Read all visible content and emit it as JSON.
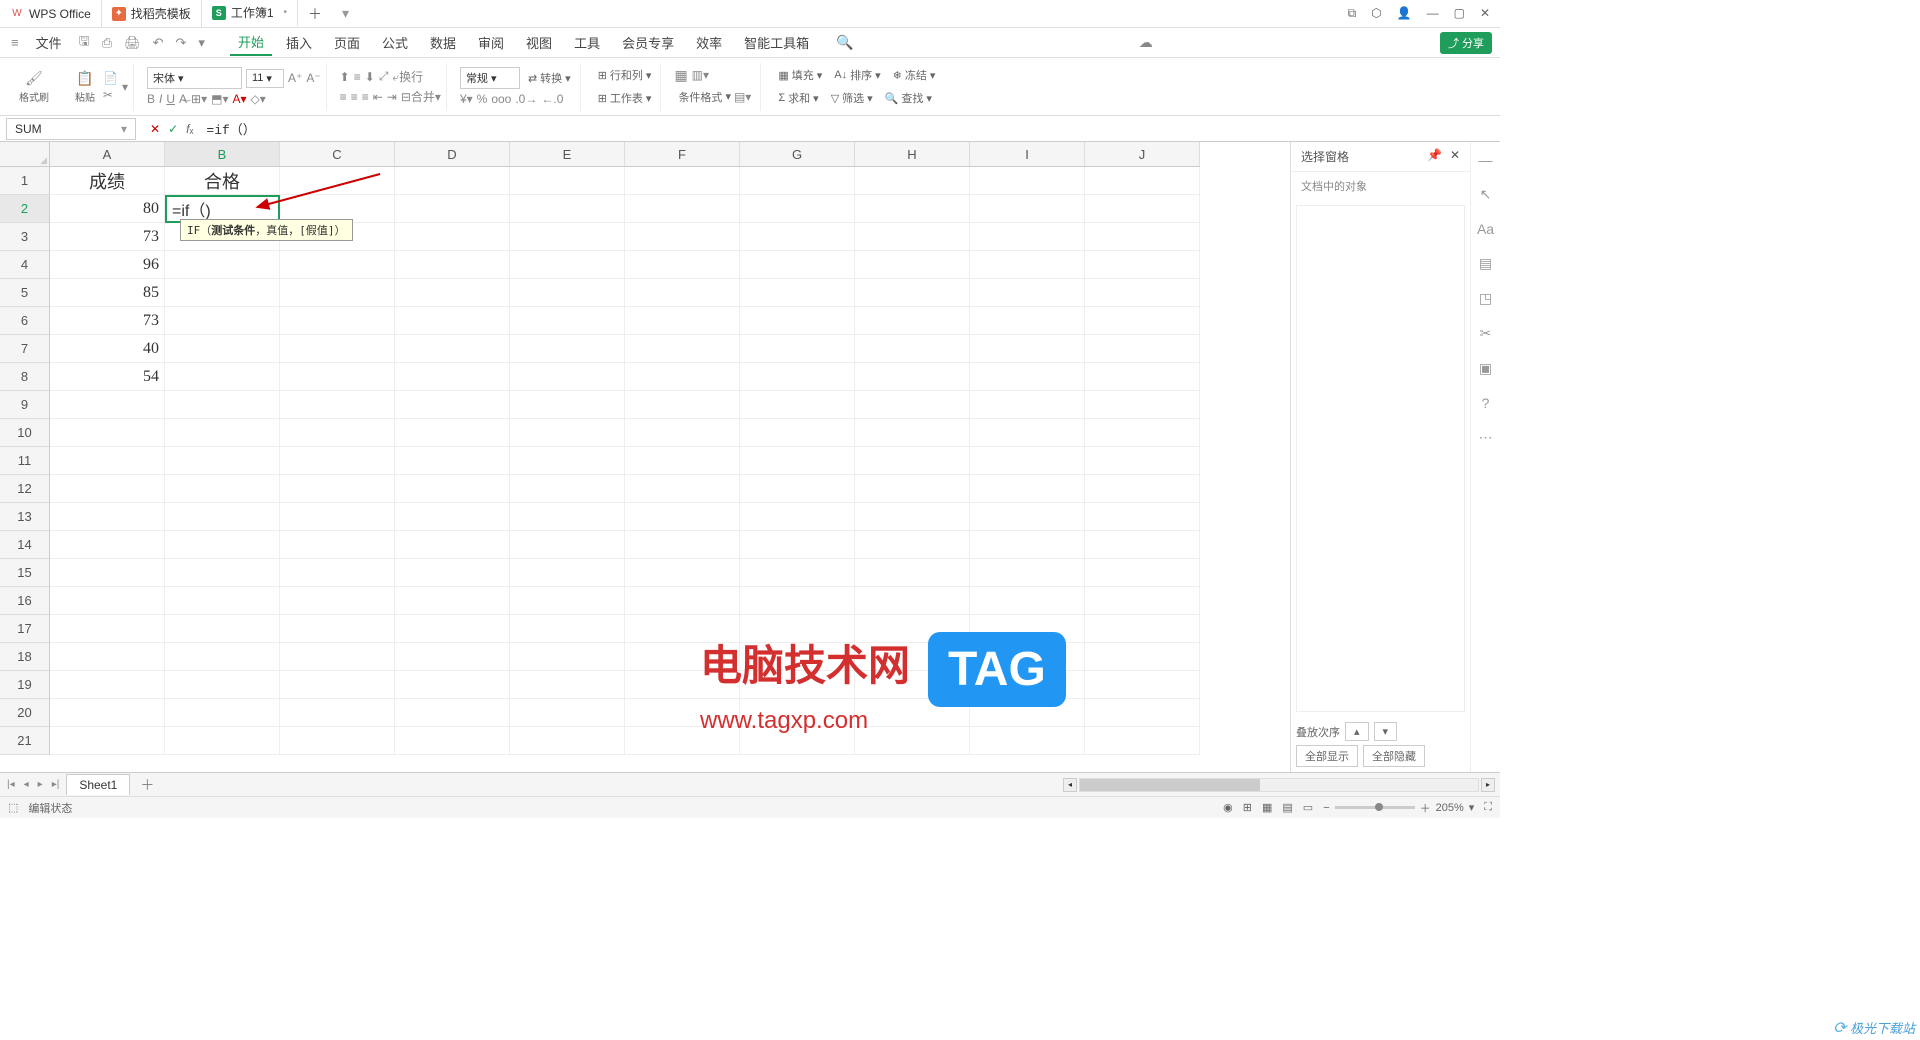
{
  "titlebar": {
    "tabs": [
      {
        "icon": "W",
        "label": "WPS Office"
      },
      {
        "icon": "✦",
        "label": "找稻壳模板"
      },
      {
        "icon": "S",
        "label": "工作簿1"
      }
    ]
  },
  "menubar": {
    "file": "文件",
    "items": [
      "开始",
      "插入",
      "页面",
      "公式",
      "数据",
      "审阅",
      "视图",
      "工具",
      "会员专享",
      "效率",
      "智能工具箱"
    ],
    "share": "分享"
  },
  "ribbon": {
    "format_painter": "格式刷",
    "paste": "粘贴",
    "font_name": "宋体",
    "font_size": "11",
    "number_format": "常规",
    "convert": "转换",
    "rows_cols": "行和列",
    "worksheet": "工作表",
    "cond_format": "条件格式",
    "fill": "填充",
    "sort": "排序",
    "freeze": "冻结",
    "sum": "求和",
    "filter": "筛选",
    "find": "查找"
  },
  "formula_bar": {
    "name_box": "SUM",
    "formula": "=if（）"
  },
  "grid": {
    "columns": [
      "A",
      "B",
      "C",
      "D",
      "E",
      "F",
      "G",
      "H",
      "I",
      "J"
    ],
    "rows": [
      1,
      2,
      3,
      4,
      5,
      6,
      7,
      8,
      9,
      10,
      11,
      12,
      13,
      14,
      15,
      16,
      17,
      18,
      19,
      20,
      21
    ],
    "header_row": {
      "A": "成绩",
      "B": "合格"
    },
    "data": {
      "A2": "80",
      "B2": "=if（)",
      "A3": "73",
      "A4": "96",
      "A5": "85",
      "A6": "73",
      "A7": "40",
      "A8": "54"
    },
    "tooltip": "IF（测试条件，真值，[假值]）",
    "active_cell": "B2"
  },
  "right_panel": {
    "title": "选择窗格",
    "subtitle": "文档中的对象",
    "stack_order": "叠放次序",
    "show_all": "全部显示",
    "hide_all": "全部隐藏"
  },
  "sheet_tabs": {
    "sheet1": "Sheet1"
  },
  "statusbar": {
    "mode": "编辑状态",
    "zoom": "205%"
  },
  "watermark": {
    "text": "电脑技术网",
    "url": "www.tagxp.com",
    "tag": "TAG",
    "corner": "极光下载站"
  }
}
